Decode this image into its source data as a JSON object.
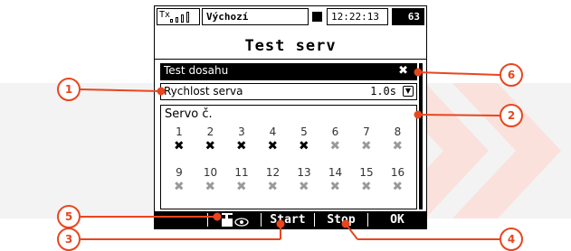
{
  "status_bar": {
    "tx_label": "Tx",
    "model_name": "Výchozí",
    "time": "12:22:13",
    "battery": "63"
  },
  "title": "Test serv",
  "rows": {
    "range_test": {
      "label": "Test dosahu",
      "value": "✖"
    },
    "servo_speed": {
      "label": "Rychlost serva",
      "value": "1.0s"
    }
  },
  "servo_section": {
    "title": "Servo č.",
    "servos": [
      {
        "num": "1",
        "state": "on"
      },
      {
        "num": "2",
        "state": "on"
      },
      {
        "num": "3",
        "state": "on"
      },
      {
        "num": "4",
        "state": "on"
      },
      {
        "num": "5",
        "state": "on"
      },
      {
        "num": "6",
        "state": "off"
      },
      {
        "num": "7",
        "state": "off"
      },
      {
        "num": "8",
        "state": "off"
      },
      {
        "num": "9",
        "state": "off"
      },
      {
        "num": "10",
        "state": "off"
      },
      {
        "num": "11",
        "state": "off"
      },
      {
        "num": "12",
        "state": "off"
      },
      {
        "num": "13",
        "state": "off"
      },
      {
        "num": "14",
        "state": "off"
      },
      {
        "num": "15",
        "state": "off"
      },
      {
        "num": "16",
        "state": "off"
      }
    ],
    "mark_glyph": "✖"
  },
  "softkeys": {
    "start": "Start",
    "stop": "Stop",
    "ok": "OK"
  },
  "callouts": [
    "1",
    "2",
    "3",
    "4",
    "5",
    "6"
  ],
  "colors": {
    "callout": "#e8461e",
    "watermark": "#f3f3f3",
    "watermark_accent": "#fbe1dc"
  }
}
